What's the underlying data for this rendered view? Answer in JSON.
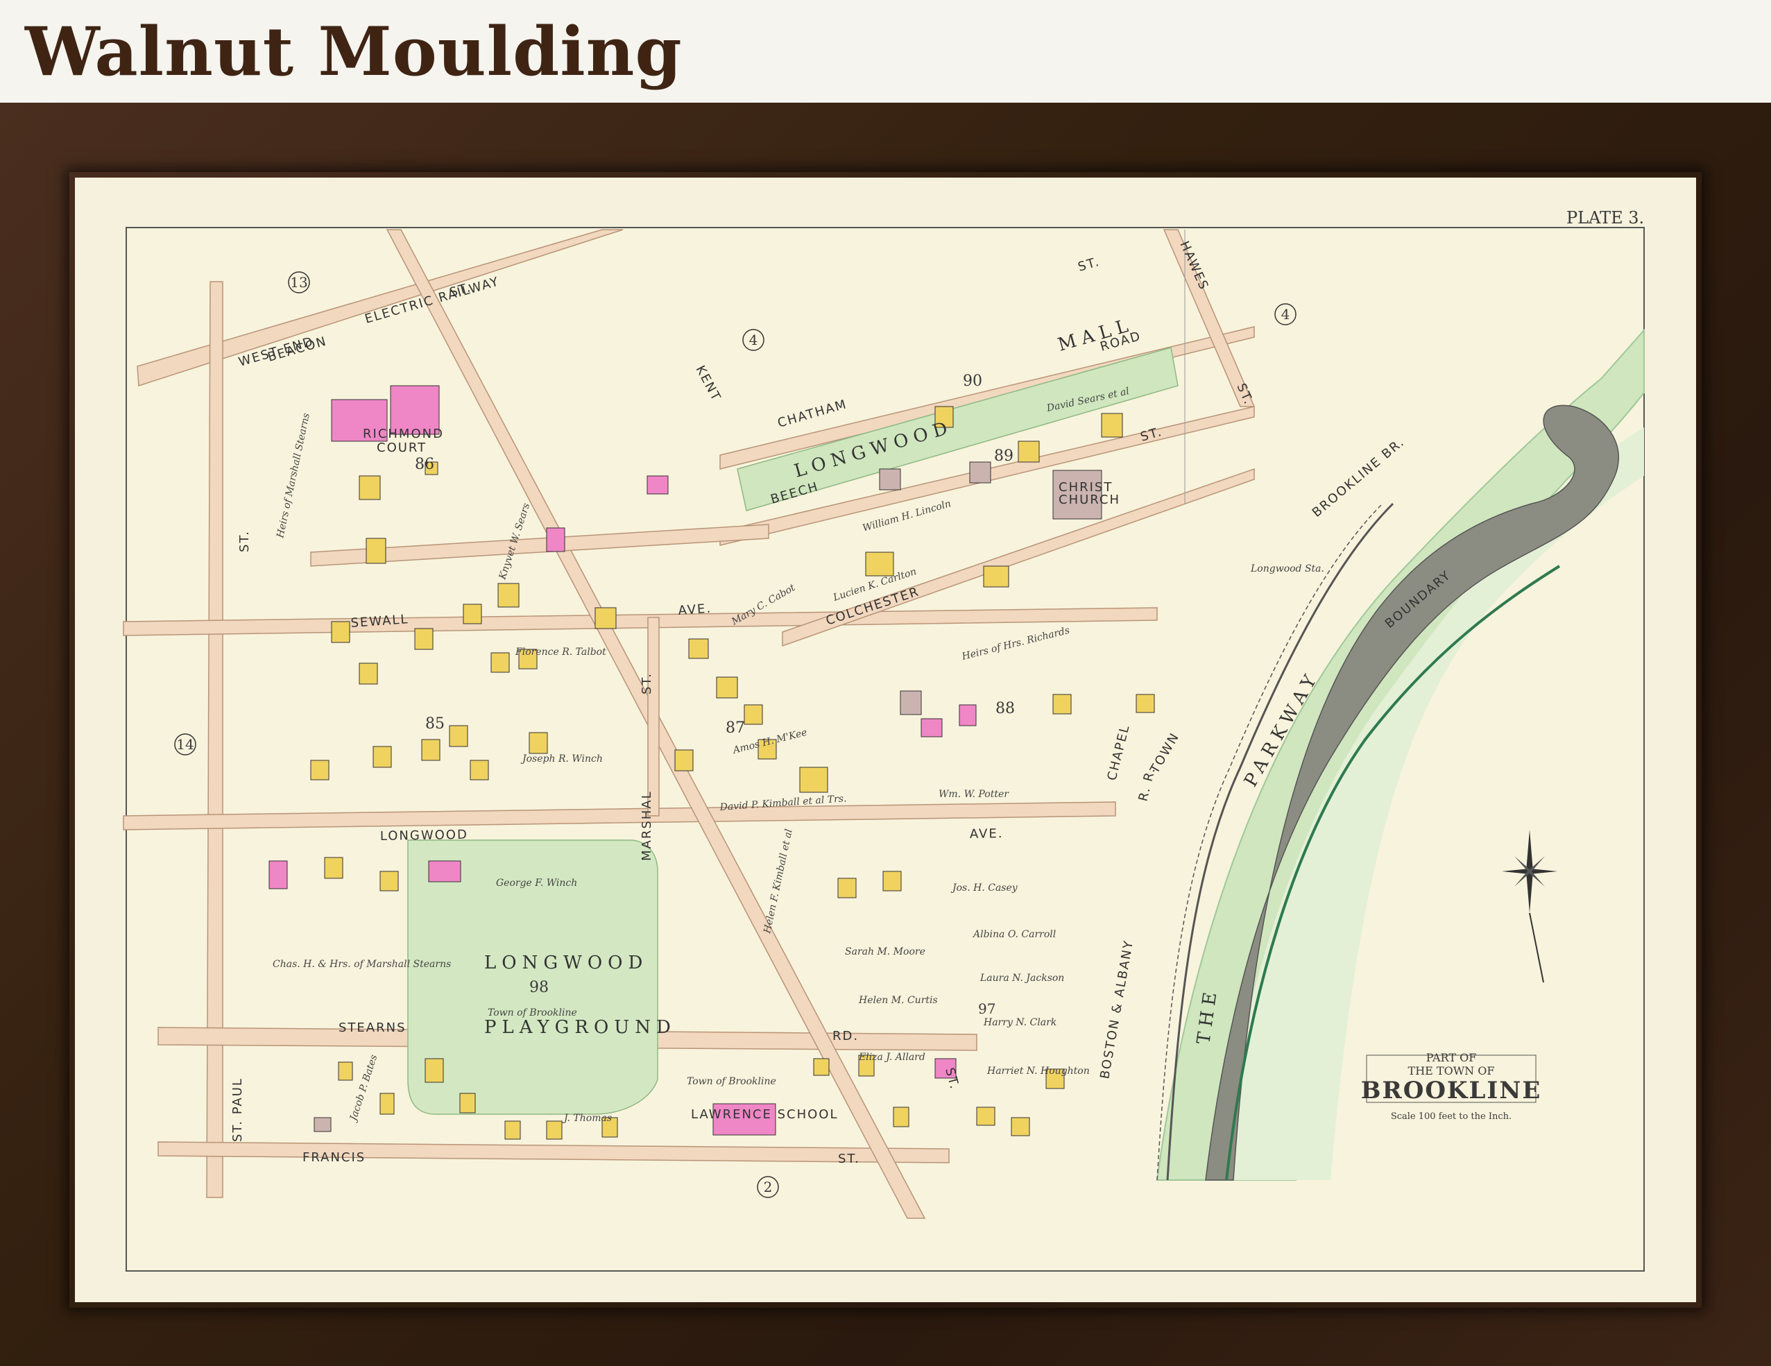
{
  "header": {
    "title": "Walnut Moulding"
  },
  "map": {
    "plate": "PLATE 3.",
    "cartouche": {
      "line1": "PART OF",
      "line2": "THE TOWN OF",
      "line3": "BROOKLINE",
      "scale": "Scale 100 feet to the Inch."
    },
    "streets": {
      "beacon": "BEACON",
      "beacon_st": "ST.",
      "railway": "ELECTRIC RAILWAY",
      "west_end": "WEST END",
      "kent": "KENT",
      "chatham": "CHATHAM",
      "chatham_st": "ST.",
      "road": "ROAD",
      "hawes": "HAWES",
      "hawes_st": "ST.",
      "beech": "BEECH",
      "beech_st": "ST.",
      "st_left": "ST.",
      "sewall": "SEWALL",
      "ave_sewall": "AVE.",
      "colchester": "COLCHESTER",
      "marshal": "MARSHAL",
      "marshal_st": "ST.",
      "longwood": "LONGWOOD",
      "longwood_ave": "AVE.",
      "st_paul": "ST. PAUL",
      "stearns": "STEARNS",
      "rd": "RD.",
      "francis": "FRANCIS",
      "francis_st": "ST.",
      "st_lower": "ST.",
      "chapel": "CHAPEL",
      "rr": "R. R.",
      "boston_albany": "BOSTON & ALBANY",
      "brookline_br": "BROOKLINE BR.",
      "boundary": "BOUNDARY",
      "town": "TOWN",
      "parkway": "PARKWAY",
      "the": "THE",
      "longwood_sta": "Longwood Sta."
    },
    "areas": {
      "longwood_mall_1": "LONGWOOD",
      "longwood_mall_2": "MALL",
      "playground_1": "LONGWOOD",
      "playground_2": "PLAYGROUND",
      "playground_owner": "Town of Brookline",
      "richmond_court_1": "RICHMOND",
      "richmond_court_2": "COURT",
      "christ_church_1": "CHRIST",
      "christ_church_2": "CHURCH",
      "lawrence_school": "LAWRENCE SCHOOL"
    },
    "circles": [
      "13",
      "4",
      "4",
      "14",
      "2"
    ],
    "block_numbers": [
      "86",
      "90",
      "89",
      "85",
      "87",
      "88",
      "98",
      "97"
    ],
    "owners": [
      "Heirs of Marshall Stearns",
      "Knyvet W. Sears",
      "David Sears et al",
      "William H. Lincoln",
      "Lucien K. Carlton",
      "Florence R. Talbot",
      "Joseph R. Winch",
      "Amos H. M'Kee",
      "David P. Kimball et al Trs.",
      "Wm. W. Potter",
      "Heirs of Hrs. Richards",
      "George F. Winch",
      "Chas. H. & Hrs. of Marshall Stearns",
      "Helen F. Kimball et al",
      "Sarah M. Moore",
      "Helen M. Curtis",
      "Albina O. Carroll",
      "Laura N. Jackson",
      "Harry N. Clark",
      "Harriet N. Houghton",
      "Jacob P. Bates",
      "J. Thomas",
      "Town of Brookline",
      "Eliza J. Allard",
      "Jos. H. Casey",
      "Mary C. Cabot"
    ]
  }
}
